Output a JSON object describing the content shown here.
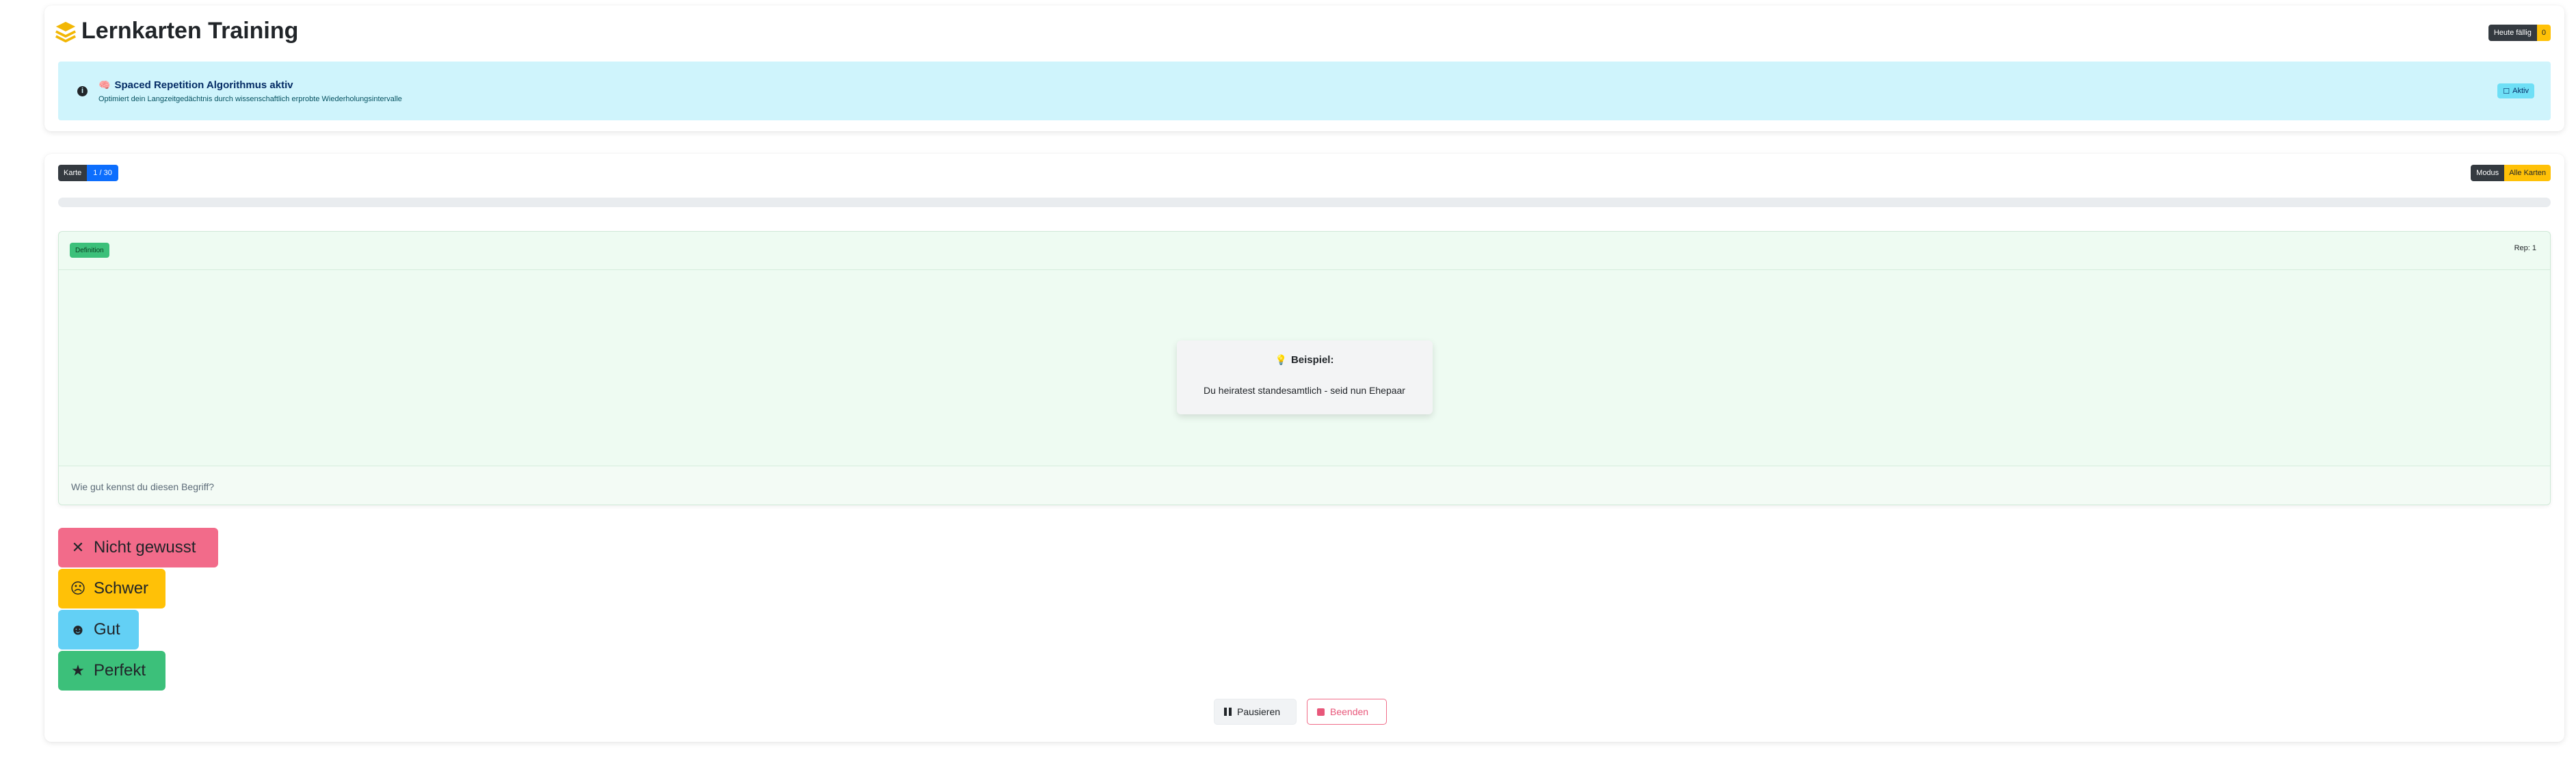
{
  "header": {
    "title": "Lernkarten Training",
    "due_label": "Heute fällig",
    "due_count": "0"
  },
  "alert": {
    "title": "Spaced Repetition Algorithmus aktiv",
    "description": "Optimiert dein Langzeitgedächtnis durch wissenschaftlich erprobte Wiederholungsintervalle",
    "status_badge": "Aktiv"
  },
  "session": {
    "card_label": "Karte",
    "card_position": "1 / 30",
    "mode_label": "Modus",
    "mode_value": "Alle Karten",
    "progress": 0.0
  },
  "card": {
    "type": "Definition",
    "repetitions": "Rep: 1",
    "example_title": "Beispiel:",
    "example_text": "Du heiratest standesamtlich - seid nun Ehepaar",
    "prompt": "Wie gut kennst du diesen Begriff?"
  },
  "ratings": [
    {
      "label": "Nicht gewusst",
      "icon": "x-icon",
      "color": "#f26b8a"
    },
    {
      "label": "Schwer",
      "icon": "sad-face-icon",
      "color": "#ffc107"
    },
    {
      "label": "Gut",
      "icon": "smile-face-icon",
      "color": "#63d0f5"
    },
    {
      "label": "Perfekt",
      "icon": "star-icon",
      "color": "#3cc07a"
    }
  ],
  "controls": {
    "pause_label": "Pausieren",
    "stop_label": "Beenden"
  },
  "colors": {
    "primary": "#0d6efd",
    "warning": "#ffc107",
    "info_bg": "#cff4fc",
    "card_bg": "#eefbf2"
  }
}
